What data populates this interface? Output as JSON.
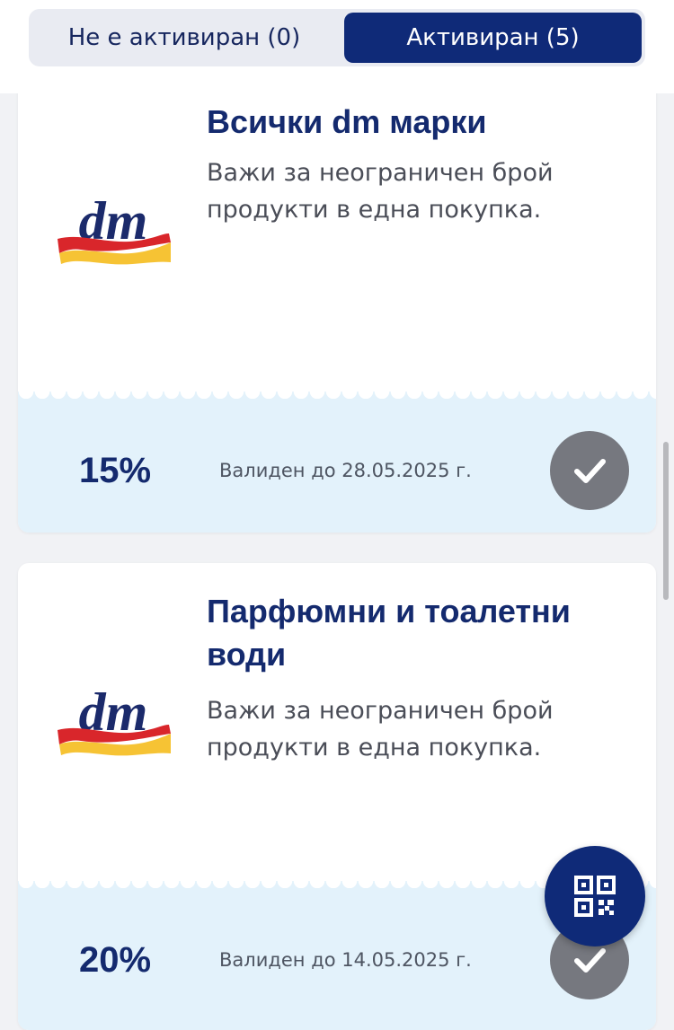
{
  "tabs": {
    "inactive_label": "Не е активиран (0)",
    "active_label": "Активиран (5)",
    "selected": "Активиран (5)"
  },
  "coupons": [
    {
      "title": "Всички dm марки",
      "description": "Важи за неограничен брой продукти в една покупка.",
      "discount": "15%",
      "valid": "Валиден до 28.05.2025 г.",
      "status_icon": "checkmark-icon",
      "activated": true
    },
    {
      "title": "Парфюмни и тоалетни води",
      "description": "Важи за неограничен брой продукти в една покупка.",
      "discount": "20%",
      "valid": "Валиден до 14.05.2025 г.",
      "status_icon": "checkmark-icon",
      "activated": true
    }
  ],
  "fab": {
    "icon": "qr-code-icon"
  },
  "colors": {
    "brand_navy": "#0f2a78",
    "title_navy": "#142a6e",
    "coupon_bottom": "#e3f2fb",
    "check_circle": "#76787f",
    "logo_red": "#d9262b",
    "logo_yellow": "#f6c334"
  }
}
